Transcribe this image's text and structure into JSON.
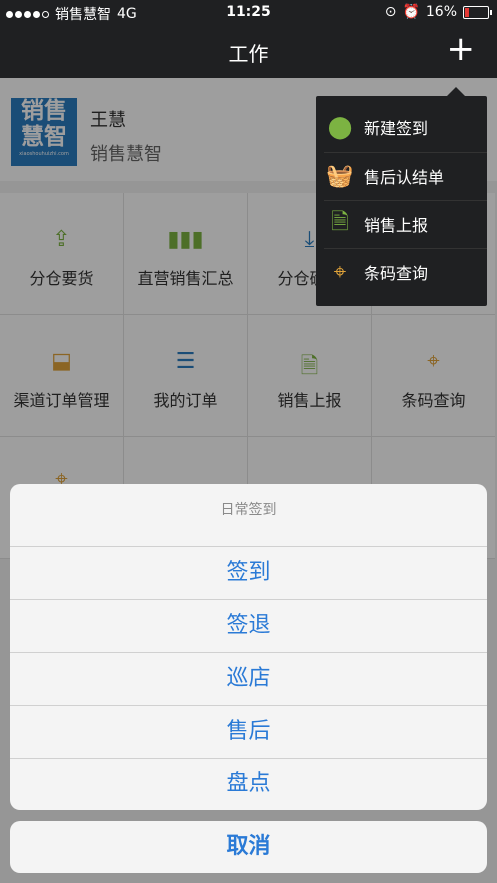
{
  "status_bar": {
    "carrier": "销售慧智",
    "network": "4G",
    "time": "11:25",
    "battery": "16%",
    "battery_level": 0.16
  },
  "nav": {
    "title": "工作"
  },
  "profile": {
    "name": "王慧",
    "company": "销售慧智",
    "logo_line1": "销售",
    "logo_line2": "慧智",
    "logo_small": "xiaoshouhuizhi.com"
  },
  "grid": [
    {
      "label": "分仓要货",
      "icon": "upload-icon",
      "color": "#7cb342"
    },
    {
      "label": "直营销售汇总",
      "icon": "bar-chart-icon",
      "color": "#7cb342"
    },
    {
      "label": "分仓确认",
      "icon": "download-icon",
      "color": "#2a7cc0"
    },
    {
      "label": "",
      "icon": "",
      "color": ""
    },
    {
      "label": "渠道订单管理",
      "icon": "inbox-icon",
      "color": "#e0a33a"
    },
    {
      "label": "我的订单",
      "icon": "list-icon",
      "color": "#2a7cc0"
    },
    {
      "label": "销售上报",
      "icon": "file-icon",
      "color": "#7cb342"
    },
    {
      "label": "条码查询",
      "icon": "crosshair-icon",
      "color": "#e0a33a"
    },
    {
      "label": "",
      "icon": "crosshair-icon",
      "color": "#e0a33a"
    },
    {
      "label": "",
      "icon": "",
      "color": ""
    },
    {
      "label": "",
      "icon": "",
      "color": ""
    },
    {
      "label": "",
      "icon": "",
      "color": ""
    }
  ],
  "dropdown": [
    {
      "label": "新建签到",
      "icon": "location-pin-icon",
      "color": "#7cb342"
    },
    {
      "label": "售后认结单",
      "icon": "basket-check-icon",
      "color": "#2a7cc0"
    },
    {
      "label": "销售上报",
      "icon": "file-icon",
      "color": "#7cb342"
    },
    {
      "label": "条码查询",
      "icon": "crosshair-icon",
      "color": "#e0a33a"
    }
  ],
  "sheet": {
    "title": "日常签到",
    "options": [
      "签到",
      "签退",
      "巡店",
      "售后",
      "盘点"
    ],
    "cancel": "取消"
  }
}
